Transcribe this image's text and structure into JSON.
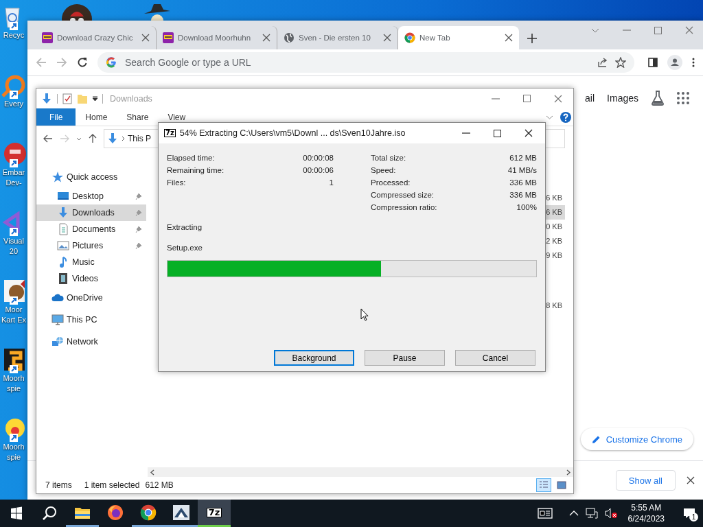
{
  "desktop": {
    "icons": [
      {
        "kind": "recycle",
        "lines": [
          "Recyc"
        ]
      },
      {
        "kind": "ring",
        "lines": [
          "Every"
        ]
      },
      {
        "kind": "red",
        "lines": [
          "Embar",
          "Dev-"
        ]
      },
      {
        "kind": "purple",
        "lines": [
          "Visual",
          "20"
        ]
      },
      {
        "kind": "bird",
        "lines": [
          "Moor",
          "Kart Ex"
        ]
      },
      {
        "kind": "game",
        "lines": [
          "Moorh",
          "spie"
        ]
      },
      {
        "kind": "yellow",
        "lines": [
          "Moorh",
          "spie"
        ]
      }
    ]
  },
  "browser": {
    "tabs": [
      {
        "kind": "game",
        "title": "Download Crazy Chic",
        "selected": false
      },
      {
        "kind": "game",
        "title": "Download Moorhuhn",
        "selected": false
      },
      {
        "kind": "globe",
        "title": "Sven - Die ersten 10",
        "selected": false
      },
      {
        "kind": "chrome",
        "title": "New Tab",
        "selected": true
      }
    ],
    "omnibox": {
      "placeholder": "Search Google or type a URL"
    },
    "header_links": [
      "ail",
      "Images"
    ],
    "customize_button": "Customize Chrome",
    "download_bar": {
      "show_all": "Show all"
    }
  },
  "explorer": {
    "title": "Downloads",
    "ribbon_tabs": [
      {
        "label": "File",
        "selected": true
      },
      {
        "label": "Home",
        "selected": false
      },
      {
        "label": "Share",
        "selected": false
      },
      {
        "label": "View",
        "selected": false
      }
    ],
    "address": "This P",
    "nav": [
      {
        "label": "Quick access",
        "kind": "star",
        "selected": false,
        "children": [
          {
            "label": "Desktop",
            "kind": "desktop",
            "pinned": true,
            "selected": false
          },
          {
            "label": "Downloads",
            "kind": "download",
            "pinned": true,
            "selected": true
          },
          {
            "label": "Documents",
            "kind": "document",
            "pinned": true,
            "selected": false
          },
          {
            "label": "Pictures",
            "kind": "picture",
            "pinned": true,
            "selected": false
          },
          {
            "label": "Music",
            "kind": "music",
            "pinned": false,
            "selected": false
          },
          {
            "label": "Videos",
            "kind": "video",
            "pinned": false,
            "selected": false
          }
        ]
      },
      {
        "label": "OneDrive",
        "kind": "cloud",
        "selected": false
      },
      {
        "label": "This PC",
        "kind": "pc",
        "selected": false
      },
      {
        "label": "Network",
        "kind": "network",
        "selected": false
      }
    ],
    "sizes": [
      {
        "text": "6 KB",
        "selected": false
      },
      {
        "text": "6 KB",
        "selected": true
      },
      {
        "text": "0 KB",
        "selected": false
      },
      {
        "text": "2 KB",
        "selected": false
      },
      {
        "text": "9 KB",
        "selected": false
      },
      {
        "text": "8 KB",
        "selected": false
      }
    ],
    "status": {
      "items": "7 items",
      "selection": "1 item selected",
      "size": "612 MB"
    },
    "views": [
      {
        "kind": "details",
        "selected": true
      },
      {
        "kind": "tiles",
        "selected": false
      }
    ]
  },
  "dialog": {
    "logo": "7z",
    "title": "54% Extracting C:\\Users\\vm5\\Downl ... ds\\Sven10Jahre.iso",
    "left_stats": [
      {
        "label": "Elapsed time:",
        "value": "00:00:08"
      },
      {
        "label": "Remaining time:",
        "value": "00:00:06"
      },
      {
        "label": "Files:",
        "value": "1"
      }
    ],
    "right_stats": [
      {
        "label": "Total size:",
        "value": "612 MB"
      },
      {
        "label": "Speed:",
        "value": "41 MB/s"
      },
      {
        "label": "Processed:",
        "value": "336 MB"
      },
      {
        "label": "Compressed size:",
        "value": "336 MB"
      },
      {
        "label": "Compression ratio:",
        "value": "100%"
      }
    ],
    "operation": "Extracting",
    "file": "Setup.exe",
    "level": 0.58,
    "buttons": [
      {
        "label": "Background",
        "focused": true
      },
      {
        "label": "Pause",
        "focused": false
      },
      {
        "label": "Cancel",
        "focused": false
      }
    ]
  },
  "taskbar": {
    "apps": [
      {
        "kind": "explorer",
        "running": true,
        "selected": false
      },
      {
        "kind": "firefox",
        "running": false,
        "selected": false
      },
      {
        "kind": "chrome",
        "running": true,
        "selected": false
      },
      {
        "kind": "app",
        "running": true,
        "selected": false
      },
      {
        "kind": "sevenzip",
        "logo": "7z",
        "running": true,
        "selected": true
      }
    ],
    "time": "5:55 AM",
    "date": "6/24/2023",
    "notifications": "1"
  }
}
